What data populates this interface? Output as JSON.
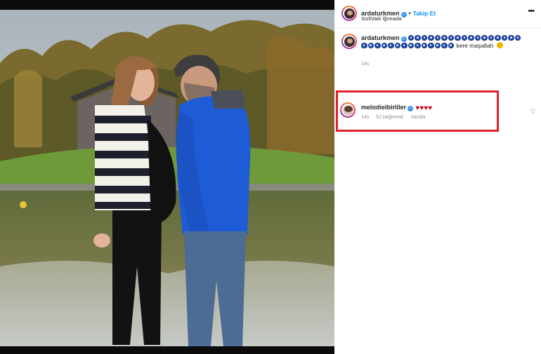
{
  "post": {
    "username": "ardaturkmen",
    "follow_label": "Takip Et",
    "location": "SisliVadi İğneada",
    "more_label": "•••"
  },
  "caption": {
    "username": "ardaturkmen",
    "eye_emoji_count": 31,
    "text_after": " kere maşallah ",
    "time": "14s"
  },
  "comment": {
    "username": "melodielbirliler",
    "hearts": "♥♥♥♥",
    "time": "14s",
    "likes": "52 beğenme",
    "reply_label": "Yanıtla"
  },
  "colors": {
    "highlight_border": "#e0202a",
    "link_blue": "#0095f6",
    "heart_red": "#d0021b"
  }
}
